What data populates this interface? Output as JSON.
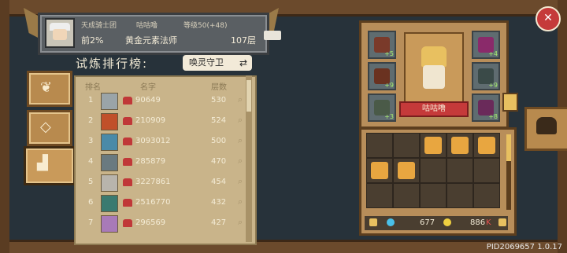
{
  "player": {
    "guild": "天成骑士团",
    "name": "咕咕噜",
    "level": "等级50(+48)",
    "rank_pct": "前2%",
    "class": "黄金元素法师",
    "floor": "107层"
  },
  "ranking": {
    "title": "试炼排行榜:",
    "mode_button": "唤灵守卫",
    "sync_icon": "⇄",
    "headers": {
      "rank": "排名",
      "name": "名字",
      "floor": "层数"
    },
    "rows": [
      {
        "rank": "1",
        "score": "90649",
        "floor": "530"
      },
      {
        "rank": "2",
        "score": "210909",
        "floor": "524"
      },
      {
        "rank": "3",
        "score": "3093012",
        "floor": "500"
      },
      {
        "rank": "4",
        "score": "285879",
        "floor": "470"
      },
      {
        "rank": "5",
        "score": "3227861",
        "floor": "454"
      },
      {
        "rank": "6",
        "score": "2516770",
        "floor": "432"
      },
      {
        "rank": "7",
        "score": "296569",
        "floor": "427"
      }
    ]
  },
  "equipment": {
    "character_name": "咕咕噜",
    "slots": [
      {
        "name": "top-left",
        "level": "+5"
      },
      {
        "name": "mid-left",
        "level": "+9"
      },
      {
        "name": "bottom-left",
        "level": "+3"
      },
      {
        "name": "top-right",
        "level": "+4"
      },
      {
        "name": "mid-right",
        "level": "+9"
      },
      {
        "name": "bottom-right",
        "level": "+8"
      }
    ]
  },
  "inventory": {
    "gems": "677",
    "coins": "886",
    "coin_suffix": "K"
  },
  "version": "PID2069657 1.0.17",
  "colors": {
    "accent_red": "#c53a3a",
    "wood": "#b88e5a",
    "panel": "#c9b48a"
  }
}
